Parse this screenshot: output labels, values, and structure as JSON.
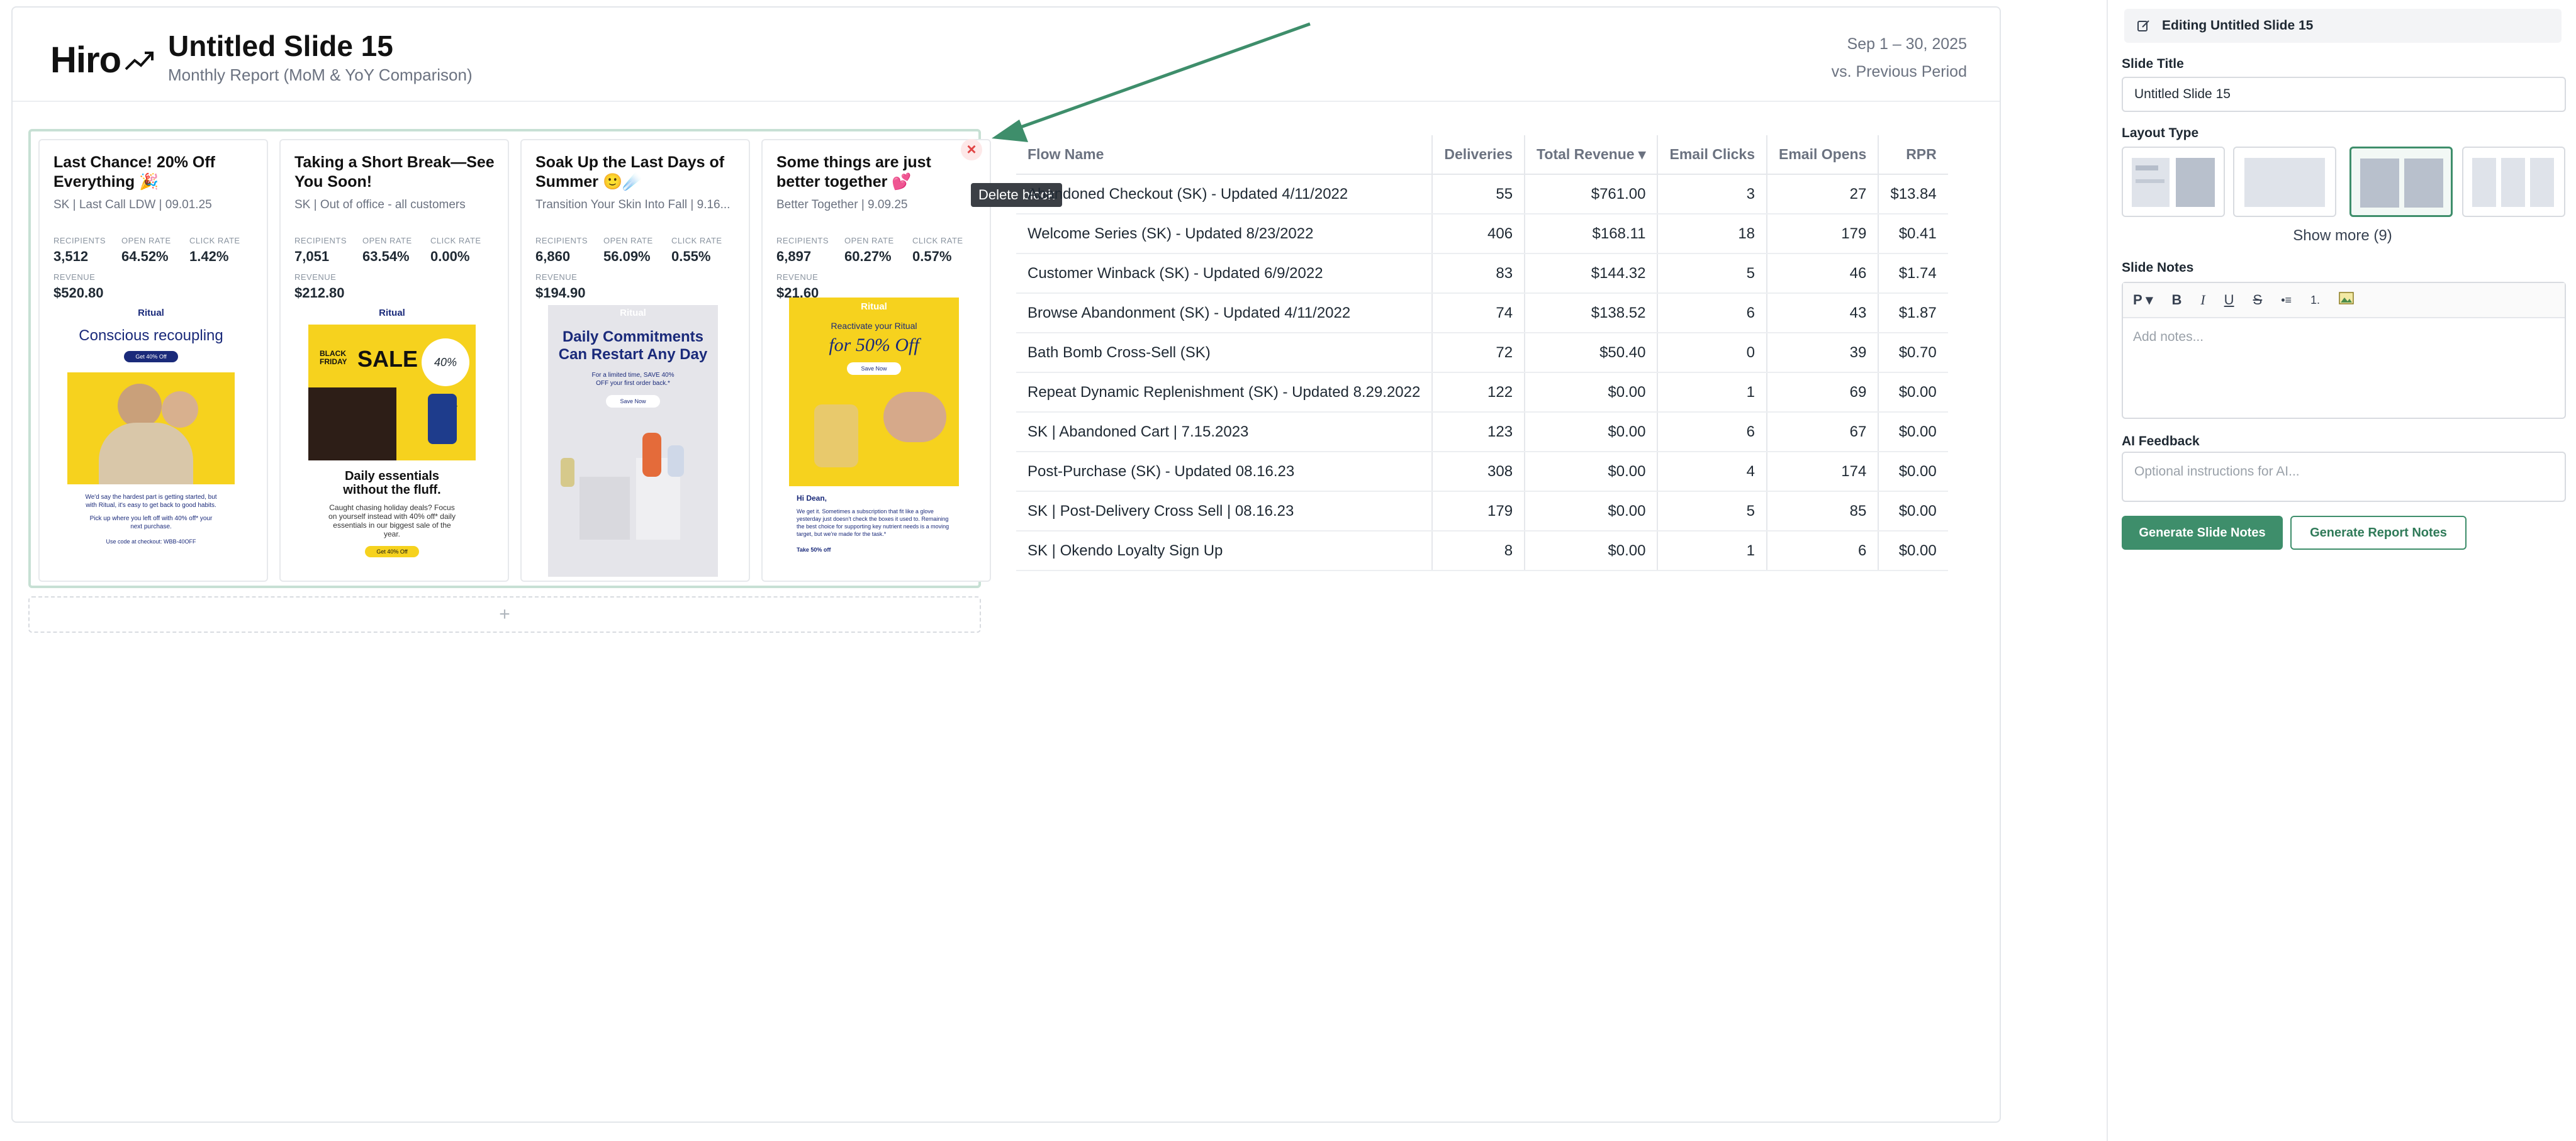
{
  "header": {
    "logo": "Hiro",
    "title": "Untitled Slide 15",
    "subtitle": "Monthly Report (MoM & YoY Comparison)",
    "date_range": "Sep 1 – 30, 2025",
    "comparison": "vs. Previous Period"
  },
  "cards": [
    {
      "title": "Last Chance! 20% Off Everything 🎉",
      "sub": "SK | Last Call LDW | 09.01.25",
      "recipients": "3,512",
      "open_rate": "64.52%",
      "click_rate": "1.42%",
      "revenue": "$520.80",
      "preview": {
        "brand": "Ritual",
        "headline": "Conscious recoupling",
        "cta": "Get 40% Off",
        "body1": "We'd say the hardest part is getting started, but with Ritual, it's easy to get back to good habits.",
        "body2": "Pick up where you left off with 40% off* your next purchase.",
        "code": "Use code at checkout: WBB-40OFF"
      }
    },
    {
      "title": "Taking a Short Break—See You Soon!",
      "sub": "SK | Out of office - all customers",
      "recipients": "7,051",
      "open_rate": "63.54%",
      "click_rate": "0.00%",
      "revenue": "$212.80",
      "preview": {
        "brand": "Ritual",
        "badge_a": "BLACK FRIDAY",
        "badge_b": "SALE",
        "badge_c": "40% OFF",
        "headline": "Daily essentials without the fluff.",
        "body1": "Caught chasing holiday deals? Focus on yourself instead with 40% off* daily essentials in our biggest sale of the year.",
        "cta": "Get 40% Off"
      }
    },
    {
      "title": "Soak Up the Last Days of Summer 🙂☄️",
      "sub": "Transition Your Skin Into Fall | 9.16...",
      "recipients": "6,860",
      "open_rate": "56.09%",
      "click_rate": "0.55%",
      "revenue": "$194.90",
      "preview": {
        "brand": "Ritual",
        "headline": "Daily Commitments Can Restart Any Day",
        "body1": "For a limited time, SAVE 40% OFF your first order back.*",
        "cta": "Save Now"
      }
    },
    {
      "title": "Some things are just better together 💕",
      "sub": "Better Together | 9.09.25",
      "recipients": "6,897",
      "open_rate": "60.27%",
      "click_rate": "0.57%",
      "revenue": "$21.60",
      "preview": {
        "brand": "Ritual",
        "headline_a": "Reactivate your Ritual",
        "headline_b": "for 50% Off",
        "cta": "Save Now",
        "greeting": "Hi Dean,",
        "body1": "We get it. Sometimes a subscription that fit like a glove yesterday just doesn't check the boxes it used to. Remaining the best choice for supporting key nutrient needs is a moving target, but we're made for the task.*",
        "footer": "Take 50% off"
      }
    }
  ],
  "stat_labels": {
    "recipients": "RECIPIENTS",
    "open_rate": "OPEN RATE",
    "click_rate": "CLICK RATE",
    "revenue": "REVENUE"
  },
  "add_block": "+",
  "delete_tooltip": "Delete block",
  "close_icon": "×",
  "table": {
    "columns": [
      "Flow Name",
      "Deliveries",
      "Total Revenue ▾",
      "Email Clicks",
      "Email Opens",
      "RPR"
    ],
    "rows": [
      [
        "Abandoned Checkout (SK) - Updated 4/11/2022",
        "55",
        "$761.00",
        "3",
        "27",
        "$13.84"
      ],
      [
        "Welcome Series (SK) - Updated 8/23/2022",
        "406",
        "$168.11",
        "18",
        "179",
        "$0.41"
      ],
      [
        "Customer Winback (SK) - Updated 6/9/2022",
        "83",
        "$144.32",
        "5",
        "46",
        "$1.74"
      ],
      [
        "Browse Abandonment (SK) - Updated 4/11/2022",
        "74",
        "$138.52",
        "6",
        "43",
        "$1.87"
      ],
      [
        "Bath Bomb Cross-Sell (SK)",
        "72",
        "$50.40",
        "0",
        "39",
        "$0.70"
      ],
      [
        "Repeat Dynamic Replenishment (SK) - Updated 8.29.2022",
        "122",
        "$0.00",
        "1",
        "69",
        "$0.00"
      ],
      [
        "SK | Abandoned Cart | 7.15.2023",
        "123",
        "$0.00",
        "6",
        "67",
        "$0.00"
      ],
      [
        "Post-Purchase (SK) - Updated 08.16.23",
        "308",
        "$0.00",
        "4",
        "174",
        "$0.00"
      ],
      [
        "SK | Post-Delivery Cross Sell | 08.16.23",
        "179",
        "$0.00",
        "5",
        "85",
        "$0.00"
      ],
      [
        "SK | Okendo Loyalty Sign Up",
        "8",
        "$0.00",
        "1",
        "6",
        "$0.00"
      ]
    ]
  },
  "panel": {
    "editing": "Editing Untitled Slide 15",
    "slide_title_label": "Slide Title",
    "slide_title_value": "Untitled Slide 15",
    "layout_label": "Layout Type",
    "show_more": "Show more (9)",
    "notes_label": "Slide Notes",
    "toolbar": {
      "para": "P ▾",
      "bold": "B",
      "italic": "I",
      "underline": "U",
      "strike": "S",
      "bullets": "•≡",
      "numbered": "1."
    },
    "notes_placeholder": "Add notes...",
    "ai_label": "AI Feedback",
    "ai_placeholder": "Optional instructions for AI...",
    "btn_slide_notes": "Generate Slide Notes",
    "btn_report_notes": "Generate Report Notes"
  },
  "colors": {
    "accent": "#3e8e6b",
    "selected_border": "#c7e0d4",
    "delete": "#e14545"
  }
}
